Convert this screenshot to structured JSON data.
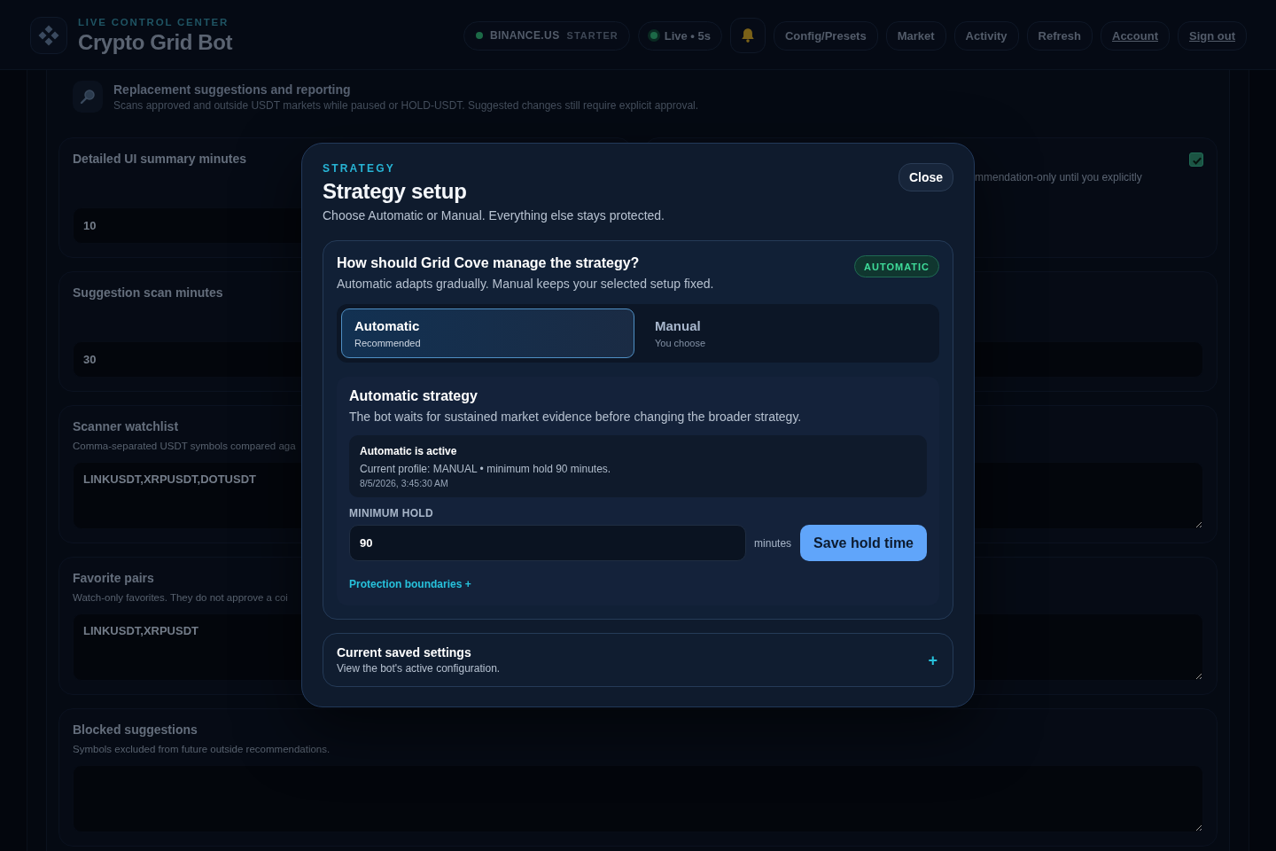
{
  "header": {
    "eyebrow": "LIVE CONTROL CENTER",
    "title": "Crypto Grid Bot",
    "exchange": {
      "name": "BINANCE.US",
      "plan": "STARTER"
    },
    "live": "Live • 5s",
    "nav": [
      {
        "label": "Config/Presets",
        "kind": "button"
      },
      {
        "label": "Market",
        "kind": "button"
      },
      {
        "label": "Activity",
        "kind": "button"
      },
      {
        "label": "Refresh",
        "kind": "button"
      },
      {
        "label": "Account",
        "kind": "link"
      },
      {
        "label": "Sign out",
        "kind": "link"
      }
    ]
  },
  "section": {
    "title": "Replacement suggestions and reporting",
    "description": "Scans approved and outside USDT markets while paused or HOLD-USDT. Suggested changes still require explicit approval."
  },
  "settings": [
    {
      "kind": "number",
      "title": "Detailed UI summary minutes",
      "value": "10"
    },
    {
      "kind": "toggle",
      "description": "mmendation-only until you explicitly",
      "checked": true
    },
    {
      "kind": "number",
      "title": "Suggestion scan minutes",
      "value": "30"
    },
    {
      "kind": "number"
    },
    {
      "kind": "list",
      "title": "Scanner watchlist",
      "description": "Comma-separated USDT symbols compared aga",
      "value": "LINKUSDT,XRPUSDT,DOTUSDT"
    },
    {
      "kind": "list",
      "title": "Favorite pairs",
      "description": "Watch-only favorites. They do not approve a coi",
      "value": "LINKUSDT,XRPUSDT"
    },
    {
      "kind": "list",
      "title": "Blocked suggestions",
      "description": "Symbols excluded from future outside recommendations."
    }
  ],
  "modal": {
    "eyebrow": "STRATEGY",
    "title": "Strategy setup",
    "subtitle": "Choose Automatic or Manual. Everything else stays protected.",
    "close": "Close",
    "mode_card": {
      "question": "How should Grid Cove manage the strategy?",
      "hint": "Automatic adapts gradually. Manual keeps your selected setup fixed.",
      "badge": "AUTOMATIC",
      "options": [
        {
          "label": "Automatic",
          "caption": "Recommended",
          "selected": true
        },
        {
          "label": "Manual",
          "caption": "You choose",
          "selected": false
        }
      ],
      "strategy": {
        "title": "Automatic strategy",
        "description": "The bot waits for sustained market evidence before changing the broader strategy.",
        "status": {
          "title": "Automatic is active",
          "detail": "Current profile: MANUAL • minimum hold 90 minutes.",
          "timestamp": "8/5/2026, 3:45:30 AM"
        },
        "hold": {
          "label": "MINIMUM HOLD",
          "value": "90",
          "unit": "minutes",
          "save": "Save hold time"
        },
        "link": "Protection boundaries +"
      }
    },
    "saved_settings": {
      "title": "Current saved settings",
      "description": "View the bot's active configuration.",
      "expand": "+"
    }
  }
}
